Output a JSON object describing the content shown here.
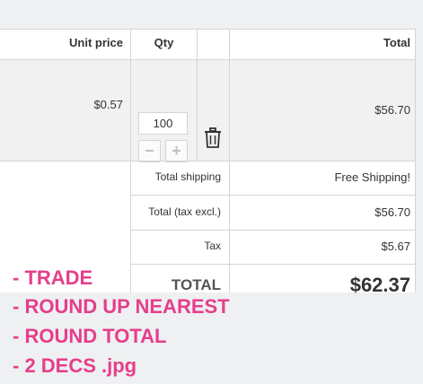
{
  "table": {
    "headers": {
      "unit_price": "Unit price",
      "qty": "Qty",
      "total": "Total"
    },
    "row": {
      "unit_price": "$0.57",
      "qty": "100",
      "total": "$56.70"
    }
  },
  "summary": {
    "shipping_label": "Total shipping",
    "shipping_value": "Free Shipping!",
    "tax_excl_label": "Total (tax excl.)",
    "tax_excl_value": "$56.70",
    "tax_label": "Tax",
    "tax_value": "$5.67",
    "total_label": "TOTAL",
    "total_value": "$62.37"
  },
  "notes": [
    "- TRADE",
    "- ROUND UP NEAREST",
    "- ROUND TOTAL",
    "- 2 DECS .jpg"
  ],
  "icons": {
    "minus": "minus-icon",
    "plus": "plus-icon",
    "delete": "trash-icon"
  },
  "colors": {
    "note": "#e63e8c",
    "row_bg": "#f1f1f1",
    "border": "#d6d4d4"
  }
}
